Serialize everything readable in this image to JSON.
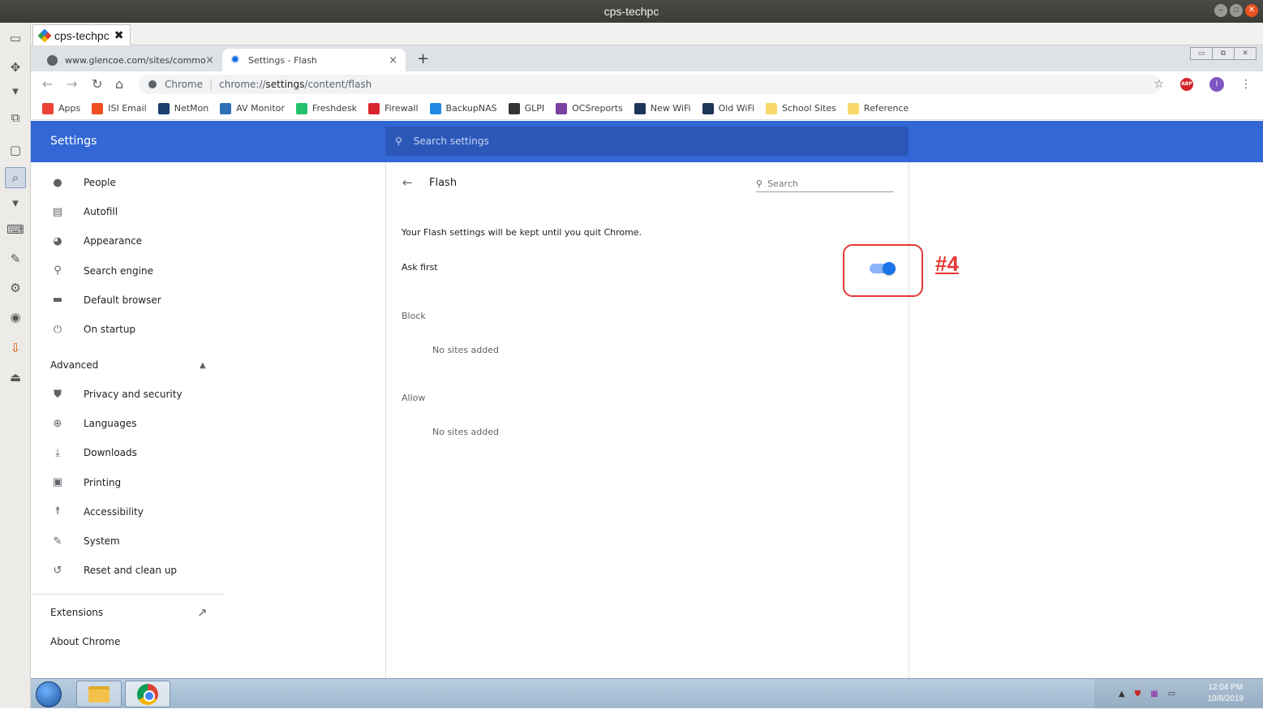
{
  "outer_window": {
    "title": "cps-techpc",
    "buttons": [
      "minimize",
      "maximize",
      "close"
    ]
  },
  "session_tab": {
    "label": "cps-techpc",
    "close": "✖"
  },
  "tabs": [
    {
      "label": "www.glencoe.com/sites/commo",
      "close": "×",
      "active": false
    },
    {
      "label": "Settings - Flash",
      "close": "×",
      "active": true
    }
  ],
  "new_tab": "+",
  "omnibox": {
    "site": "Chrome",
    "url_prefix": "chrome://",
    "url_host": "settings",
    "url_path": "/content/flash"
  },
  "bookmarks": [
    {
      "label": "Apps",
      "color": "#ea4335"
    },
    {
      "label": "ISI Email",
      "color": "#f25022"
    },
    {
      "label": "NetMon",
      "color": "#1a3e6e"
    },
    {
      "label": "AV Monitor",
      "color": "#2e6fb8"
    },
    {
      "label": "Freshdesk",
      "color": "#25c16f"
    },
    {
      "label": "Firewall",
      "color": "#d9232d"
    },
    {
      "label": "BackupNAS",
      "color": "#1e88e5"
    },
    {
      "label": "GLPI",
      "color": "#333333"
    },
    {
      "label": "OCSreports",
      "color": "#7b3fa0"
    },
    {
      "label": "New WiFi",
      "color": "#1d3557"
    },
    {
      "label": "Old WiFi",
      "color": "#1d3557"
    },
    {
      "label": "School Sites",
      "color": "#f9d86b"
    },
    {
      "label": "Reference",
      "color": "#f9d86b"
    }
  ],
  "header": {
    "title": "Settings",
    "search_placeholder": "Search settings"
  },
  "sidebar": {
    "items": [
      {
        "label": "People",
        "icon": "person-icon"
      },
      {
        "label": "Autofill",
        "icon": "clipboard-icon"
      },
      {
        "label": "Appearance",
        "icon": "palette-icon"
      },
      {
        "label": "Search engine",
        "icon": "search-icon"
      },
      {
        "label": "Default browser",
        "icon": "browser-icon"
      },
      {
        "label": "On startup",
        "icon": "power-icon"
      }
    ],
    "advanced_label": "Advanced",
    "advanced_items": [
      {
        "label": "Privacy and security",
        "icon": "shield-icon"
      },
      {
        "label": "Languages",
        "icon": "globe-icon"
      },
      {
        "label": "Downloads",
        "icon": "download-icon"
      },
      {
        "label": "Printing",
        "icon": "printer-icon"
      },
      {
        "label": "Accessibility",
        "icon": "accessibility-icon"
      },
      {
        "label": "System",
        "icon": "wrench-icon"
      },
      {
        "label": "Reset and clean up",
        "icon": "history-icon"
      }
    ],
    "extensions_label": "Extensions",
    "about_label": "About Chrome"
  },
  "flash": {
    "title": "Flash",
    "search_placeholder": "Search",
    "note": "Your Flash settings will be kept until you quit Chrome.",
    "ask_first_label": "Ask first",
    "ask_first_enabled": true,
    "block_label": "Block",
    "block_empty": "No sites added",
    "allow_label": "Allow",
    "allow_empty": "No sites added"
  },
  "annotation": {
    "label": "#4",
    "color": "#e53935"
  },
  "taskbar": {
    "time": "12:04 PM",
    "date": "10/8/2019"
  }
}
